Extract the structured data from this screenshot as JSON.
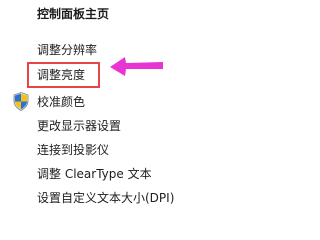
{
  "panel": {
    "home_link": "控制面板主页",
    "tasks": [
      {
        "label": "调整分辨率"
      },
      {
        "label": "调整亮度"
      },
      {
        "label": "校准颜色",
        "icon": "shield-icon"
      },
      {
        "label": "更改显示器设置"
      },
      {
        "label": "连接到投影仪"
      },
      {
        "label": "调整 ClearType 文本"
      },
      {
        "label": "设置自定义文本大小(DPI)"
      }
    ]
  },
  "annotation": {
    "highlight_color": "#e8454a",
    "arrow_color": "#e834d4",
    "highlighted_task": "调整亮度"
  },
  "colors": {
    "text": "#1e1e1e",
    "background": "#ffffff"
  }
}
